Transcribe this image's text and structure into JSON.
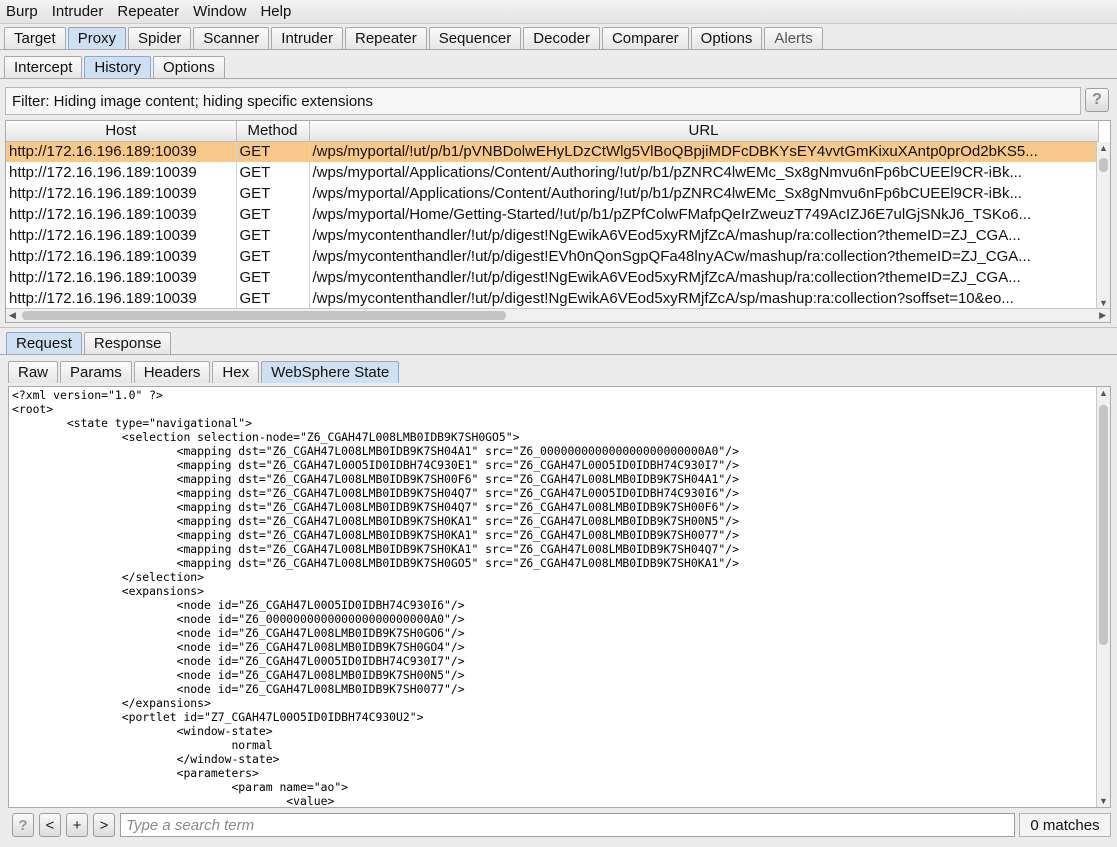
{
  "menu": [
    "Burp",
    "Intruder",
    "Repeater",
    "Window",
    "Help"
  ],
  "main_tabs": [
    "Target",
    "Proxy",
    "Spider",
    "Scanner",
    "Intruder",
    "Repeater",
    "Sequencer",
    "Decoder",
    "Comparer",
    "Options",
    "Alerts"
  ],
  "sub_tabs": [
    "Intercept",
    "History",
    "Options"
  ],
  "filter_text": "Filter: Hiding image content;  hiding specific extensions",
  "help_label": "?",
  "table": {
    "columns": [
      "Host",
      "Method",
      "URL"
    ],
    "rows": [
      {
        "host": "http://172.16.196.189:10039",
        "method": "GET",
        "url": "/wps/myportal/!ut/p/b1/pVNBDolwEHyLDzCtWlg5VlBoQBpjiMDFcDBKYsEY4vvtGmKixuXAntp0prOd2bKS5..."
      },
      {
        "host": "http://172.16.196.189:10039",
        "method": "GET",
        "url": "/wps/myportal/Applications/Content/Authoring/!ut/p/b1/pZNRC4lwEMc_Sx8gNmvu6nFp6bCUEEl9CR-iBk..."
      },
      {
        "host": "http://172.16.196.189:10039",
        "method": "GET",
        "url": "/wps/myportal/Applications/Content/Authoring/!ut/p/b1/pZNRC4lwEMc_Sx8gNmvu6nFp6bCUEEl9CR-iBk..."
      },
      {
        "host": "http://172.16.196.189:10039",
        "method": "GET",
        "url": "/wps/myportal/Home/Getting-Started/!ut/p/b1/pZPfColwFMafpQeIrZweuzT749AcIZJ6E7ulGjSNkJ6_TSKo6..."
      },
      {
        "host": "http://172.16.196.189:10039",
        "method": "GET",
        "url": "/wps/mycontenthandler/!ut/p/digest!NgEwikA6VEod5xyRMjfZcA/mashup/ra:collection?themeID=ZJ_CGA..."
      },
      {
        "host": "http://172.16.196.189:10039",
        "method": "GET",
        "url": "/wps/mycontenthandler/!ut/p/digest!EVh0nQonSgpQFa48lnyACw/mashup/ra:collection?themeID=ZJ_CGA..."
      },
      {
        "host": "http://172.16.196.189:10039",
        "method": "GET",
        "url": "/wps/mycontenthandler/!ut/p/digest!NgEwikA6VEod5xyRMjfZcA/mashup/ra:collection?themeID=ZJ_CGA..."
      },
      {
        "host": "http://172.16.196.189:10039",
        "method": "GET",
        "url": "/wps/mycontenthandler/!ut/p/digest!NgEwikA6VEod5xyRMjfZcA/sp/mashup:ra:collection?soffset=10&eo..."
      }
    ]
  },
  "req_resp_tabs": [
    "Request",
    "Response"
  ],
  "view_tabs": [
    "Raw",
    "Params",
    "Headers",
    "Hex",
    "WebSphere State"
  ],
  "editor_content": "<?xml version=\"1.0\" ?>\n<root>\n        <state type=\"navigational\">\n                <selection selection-node=\"Z6_CGAH47L008LMB0IDB9K7SH0GO5\">\n                        <mapping dst=\"Z6_CGAH47L008LMB0IDB9K7SH04A1\" src=\"Z6_000000000000000000000000A0\"/>\n                        <mapping dst=\"Z6_CGAH47L00O5ID0IDBH74C930E1\" src=\"Z6_CGAH47L00O5ID0IDBH74C930I7\"/>\n                        <mapping dst=\"Z6_CGAH47L008LMB0IDB9K7SH00F6\" src=\"Z6_CGAH47L008LMB0IDB9K7SH04A1\"/>\n                        <mapping dst=\"Z6_CGAH47L008LMB0IDB9K7SH04Q7\" src=\"Z6_CGAH47L00O5ID0IDBH74C930I6\"/>\n                        <mapping dst=\"Z6_CGAH47L008LMB0IDB9K7SH04Q7\" src=\"Z6_CGAH47L008LMB0IDB9K7SH00F6\"/>\n                        <mapping dst=\"Z6_CGAH47L008LMB0IDB9K7SH0KA1\" src=\"Z6_CGAH47L008LMB0IDB9K7SH00N5\"/>\n                        <mapping dst=\"Z6_CGAH47L008LMB0IDB9K7SH0KA1\" src=\"Z6_CGAH47L008LMB0IDB9K7SH0077\"/>\n                        <mapping dst=\"Z6_CGAH47L008LMB0IDB9K7SH0KA1\" src=\"Z6_CGAH47L008LMB0IDB9K7SH04Q7\"/>\n                        <mapping dst=\"Z6_CGAH47L008LMB0IDB9K7SH0GO5\" src=\"Z6_CGAH47L008LMB0IDB9K7SH0KA1\"/>\n                </selection>\n                <expansions>\n                        <node id=\"Z6_CGAH47L00O5ID0IDBH74C930I6\"/>\n                        <node id=\"Z6_000000000000000000000000A0\"/>\n                        <node id=\"Z6_CGAH47L008LMB0IDB9K7SH0GO6\"/>\n                        <node id=\"Z6_CGAH47L008LMB0IDB9K7SH0GO4\"/>\n                        <node id=\"Z6_CGAH47L00O5ID0IDBH74C930I7\"/>\n                        <node id=\"Z6_CGAH47L008LMB0IDB9K7SH00N5\"/>\n                        <node id=\"Z6_CGAH47L008LMB0IDB9K7SH0077\"/>\n                </expansions>\n                <portlet id=\"Z7_CGAH47L00O5ID0IDBH74C930U2\">\n                        <window-state>\n                                normal\n                        </window-state>\n                        <parameters>\n                                <param name=\"ao\">\n                                        <value>",
  "search": {
    "placeholder": "Type a search term",
    "matches": "0 matches",
    "buttons": [
      "?",
      "<",
      "+",
      ">"
    ]
  },
  "colors": {
    "selected_row": "#f7c88a",
    "active_tab": "#cfe0f2"
  }
}
